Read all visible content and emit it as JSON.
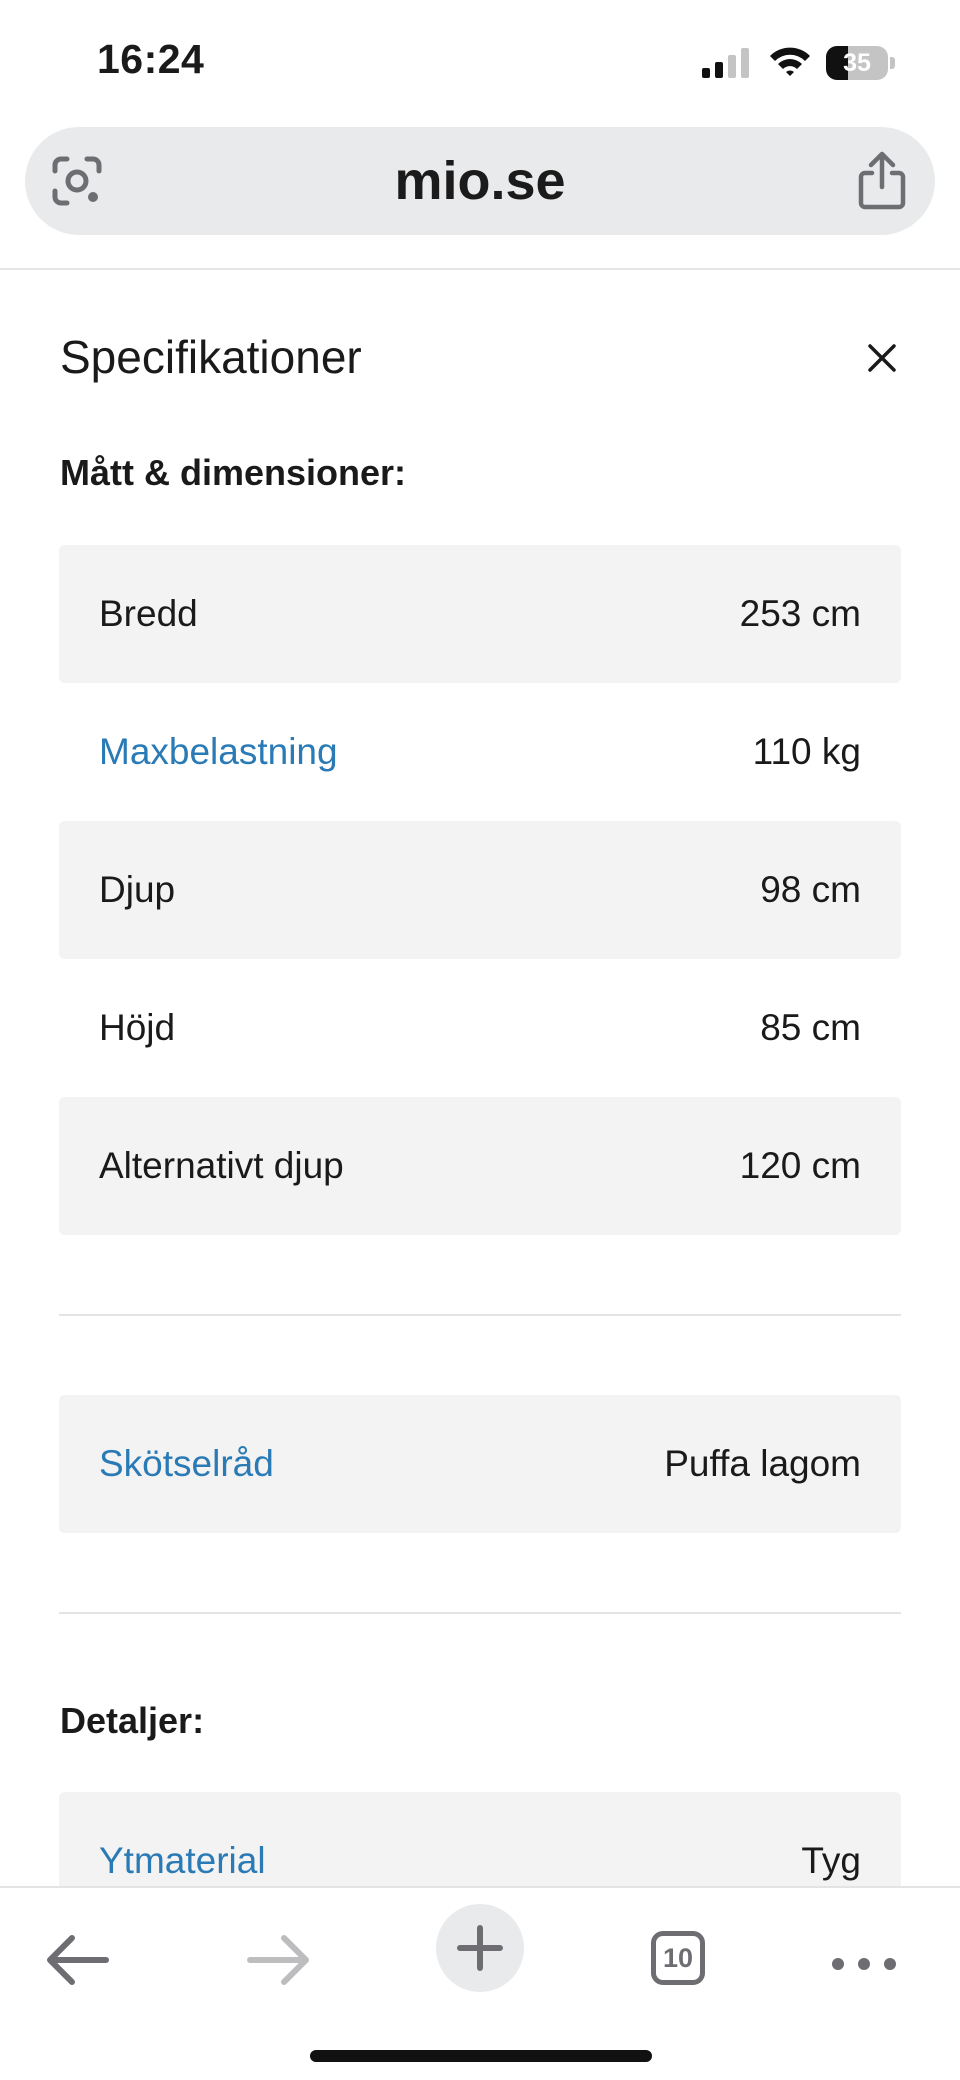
{
  "status_bar": {
    "time": "16:24",
    "battery_level": "35",
    "icons": [
      "cellular-signal-icon",
      "wifi-icon",
      "battery-icon"
    ]
  },
  "browser": {
    "url": "mio.se",
    "icons": [
      "lens-icon",
      "share-icon"
    ]
  },
  "panel": {
    "title": "Specifikationer",
    "close_icon": "close-icon"
  },
  "dimensions": {
    "heading": "Mått & dimensioner:",
    "rows": [
      {
        "label": "Bredd",
        "value": "253 cm",
        "link": false
      },
      {
        "label": "Maxbelastning",
        "value": "110 kg",
        "link": true
      },
      {
        "label": "Djup",
        "value": "98 cm",
        "link": false
      },
      {
        "label": "Höjd",
        "value": "85 cm",
        "link": false
      },
      {
        "label": "Alternativt djup",
        "value": "120 cm",
        "link": false
      }
    ]
  },
  "care": {
    "label": "Skötselråd",
    "value": "Puffa lagom"
  },
  "details": {
    "heading": "Detaljer:",
    "rows": [
      {
        "label": "Ytmaterial",
        "value": "Tyg",
        "link": true
      }
    ]
  },
  "toolbar": {
    "tabs_count": "10",
    "icons": [
      "back-arrow-icon",
      "forward-arrow-icon",
      "plus-icon",
      "tabs-icon",
      "more-icon"
    ]
  },
  "colors": {
    "link": "#2a7ab5",
    "row_shade": "#f3f3f3",
    "address_bar": "#e8eaec"
  }
}
